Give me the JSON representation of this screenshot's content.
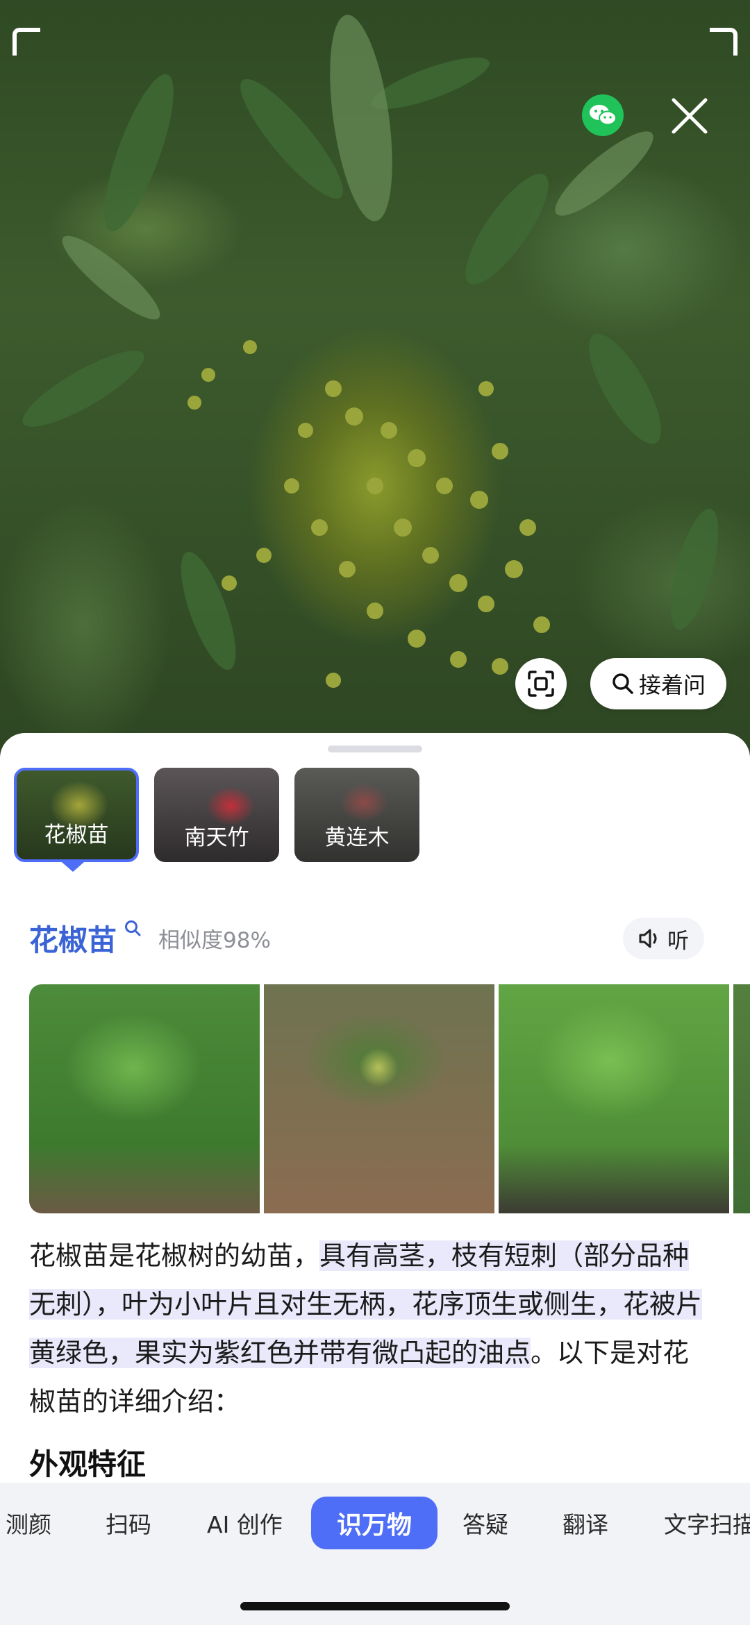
{
  "camera": {
    "wechat_icon": "wechat-icon",
    "close_icon": "close-icon",
    "scan_icon": "scan-icon",
    "ask_label": "接着问"
  },
  "results": [
    {
      "label": "花椒苗",
      "selected": true
    },
    {
      "label": "南天竹",
      "selected": false
    },
    {
      "label": "黄连木",
      "selected": false
    }
  ],
  "detail": {
    "name": "花椒苗",
    "similarity": "相似度98%",
    "listen_label": "听",
    "description_part1": "花椒苗是花椒树的幼苗，",
    "description_highlight": "具有高茎，枝有短刺（部分品种无刺），叶为小叶片且对生无柄，花序顶生或侧生，花被片黄绿色，果实为紫红色并带有微凸起的油点",
    "description_part2": "。以下是对花椒苗的详细介绍：",
    "section_title": "外观特征"
  },
  "tabs": [
    {
      "label": "测颜",
      "active": false
    },
    {
      "label": "扫码",
      "active": false
    },
    {
      "label": "AI 创作",
      "active": false
    },
    {
      "label": "识万物",
      "active": true
    },
    {
      "label": "答疑",
      "active": false
    },
    {
      "label": "翻译",
      "active": false
    },
    {
      "label": "文字扫描",
      "active": false
    }
  ],
  "colors": {
    "accent": "#4f6ef7",
    "title": "#3a63d6",
    "wechat": "#20c35a"
  }
}
